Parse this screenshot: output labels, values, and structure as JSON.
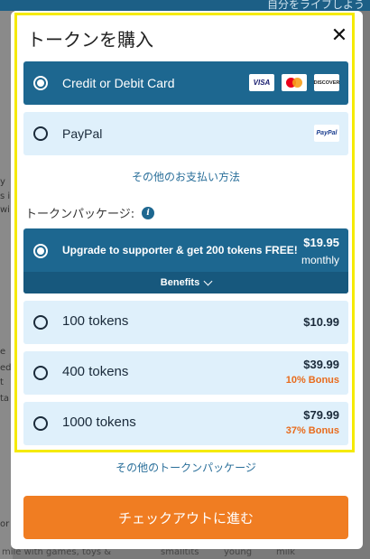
{
  "background": {
    "header_text": "自分をライブしよう",
    "left_snippets": [
      "y",
      "s in",
      "wi",
      "e",
      "ed f",
      "t",
      "ta",
      "or"
    ],
    "bottom_text": "mile with games, toys &",
    "bottom_tags": [
      "smalltits",
      "young",
      "milk"
    ]
  },
  "modal": {
    "title": "トークンを購入",
    "close_icon": "close-icon"
  },
  "payment_methods": [
    {
      "label": "Credit or Debit Card",
      "selected": true,
      "icons": [
        "VISA",
        "mastercard",
        "DISCOVER"
      ]
    },
    {
      "label": "PayPal",
      "selected": false,
      "icons": [
        "PayPal"
      ]
    }
  ],
  "other_payment_link": "その他のお支払い方法",
  "package_section_label": "トークンパッケージ:",
  "featured_package": {
    "title": "Upgrade to supporter & get 200 tokens FREE!",
    "price": "$19.95",
    "period": "monthly",
    "benefits_label": "Benefits",
    "selected": true
  },
  "packages": [
    {
      "title": "100 tokens",
      "price": "$10.99",
      "bonus": ""
    },
    {
      "title": "400 tokens",
      "price": "$39.99",
      "bonus": "10% Bonus"
    },
    {
      "title": "1000 tokens",
      "price": "$79.99",
      "bonus": "37% Bonus"
    }
  ],
  "other_packages_link": "その他のトークンパッケージ",
  "checkout_button": "チェックアウトに進む",
  "colors": {
    "primary": "#1d6790",
    "light": "#dff0fb",
    "accent": "#f07d22",
    "bonus": "#e86b1c",
    "highlight": "#f5ea00"
  }
}
